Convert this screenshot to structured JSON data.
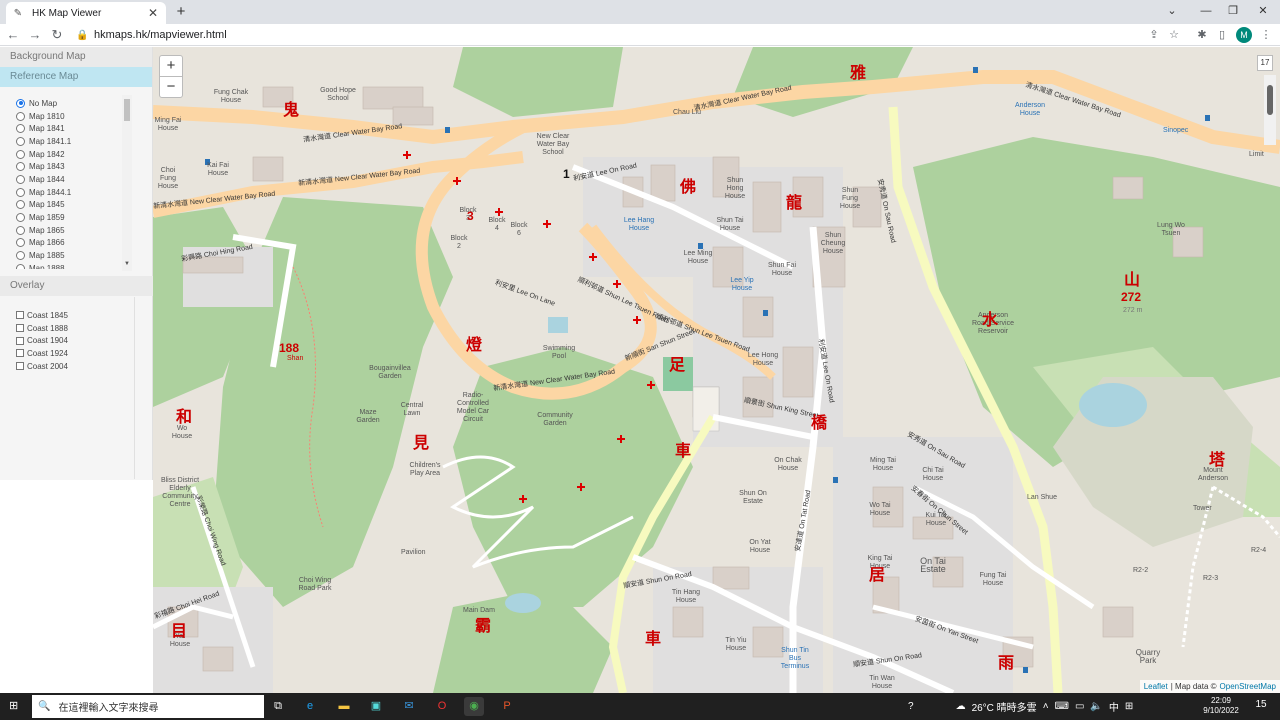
{
  "browser": {
    "tab_title": "HK Map Viewer",
    "tab_icon": "map-pin-icon",
    "new_tab": "+",
    "url": "hkmaps.hk/mapviewer.html",
    "window_buttons": [
      "⌄",
      "—",
      "❐",
      "✕"
    ],
    "avatar_letter": "M"
  },
  "sidebar": {
    "background_map_label": "Background Map",
    "reference_map_label": "Reference Map",
    "maps": [
      {
        "label": "No Map",
        "selected": true
      },
      {
        "label": "Map 1810",
        "selected": false
      },
      {
        "label": "Map 1841",
        "selected": false
      },
      {
        "label": "Map 1841.1",
        "selected": false
      },
      {
        "label": "Map 1842",
        "selected": false
      },
      {
        "label": "Map 1843",
        "selected": false
      },
      {
        "label": "Map 1844",
        "selected": false
      },
      {
        "label": "Map 1844.1",
        "selected": false
      },
      {
        "label": "Map 1845",
        "selected": false
      },
      {
        "label": "Map 1859",
        "selected": false
      },
      {
        "label": "Map 1865",
        "selected": false
      },
      {
        "label": "Map 1866",
        "selected": false
      },
      {
        "label": "Map 1885",
        "selected": false
      },
      {
        "label": "Map 1888",
        "selected": false
      }
    ],
    "overlay_label": "Overlay",
    "overlays": [
      {
        "label": "Coast 1845",
        "checked": false
      },
      {
        "label": "Coast 1888",
        "checked": false
      },
      {
        "label": "Coast 1904",
        "checked": false
      },
      {
        "label": "Coast 1924",
        "checked": false
      },
      {
        "label": "Coast 2004",
        "checked": false
      }
    ]
  },
  "map": {
    "zoom_in": "+",
    "zoom_out": "−",
    "zoom_level": "17",
    "attribution": {
      "leaflet": "Leaflet",
      "sep": "| Map data ©",
      "osm": "OpenStreetMap"
    },
    "roads": {
      "clear_water_bay_top": "清水灣道 Clear Water Bay Road",
      "clear_water_bay_right": "清水灣道 Clear Water Bay Road",
      "new_clear_water_bay": "新清水灣道 New Clear Water Bay Road",
      "new_clear_water_bay_left": "新清水灣道 New Clear Water Bay Road",
      "choi_hing": "彩興路 Choi Hing Road",
      "lee_on": "利安道 Lee On Road",
      "shun_lee_tsuen": "順利邨道 Shun Lee Tsuen Road",
      "on_sau": "安秀道 On Sau Road",
      "shun_king": "順景街 Shun King Street",
      "shun_on": "順安道 Shun On Road",
      "on_tat": "安達道 On Tat Road",
      "lee_on_lane": "利安里 Lee On Lane",
      "san_shun": "新順街 San Shun Street",
      "choi_wing": "彩榮路 Choi Wing Road",
      "choi_hei": "彩禧路 Choi Hei Road",
      "shun_lee_tsuen_2": "順利邨道 Shun Lee Tsuen Road",
      "on_chun": "安春街 On Chun Street",
      "on_yan": "安茵街 On Yan Street"
    },
    "places": {
      "chau_liu": "Chau Liu",
      "fung_chak": "Fung Chak House",
      "good_hope": "Good Hope School",
      "kai_fai": "Kai Fai House",
      "ming_fai": "Ming Fai House",
      "choi_hing_house": "Choi Fung House",
      "block3": "Block 3",
      "block4": "Block 4",
      "block6": "Block 6",
      "block2": "Block 2",
      "shun_hong": "Shun Hong House",
      "shun_tai": "Shun Tai House",
      "shun_fung": "Shun Fung House",
      "shun_cheung": "Shun Cheung House",
      "shun_fai": "Shun Fai House",
      "lee_ming": "Lee Ming House",
      "lee_yip": "Lee Yip House",
      "lee_hong": "Lee Hong House",
      "lee_hang": "Lee Hang House",
      "swimming_pool": "Swimming Pool",
      "bougainvillea": "Bougainvillea Garden",
      "central_lawn": "Central Lawn",
      "maze_garden": "Maze Garden",
      "radio_model": "Radio-Controlled Model Car Circuit",
      "community_garden": "Community Garden",
      "childrens_play": "Children's Play Area",
      "wo_house": "Wo House",
      "bliss": "Bliss District Elderly Community Centre",
      "pavilion": "Pavilion",
      "choi_wing_park": "Choi Wing Road Park",
      "yat_house": "Yat House",
      "main_dam": "Main Dam",
      "shun_on_estate": "Shun On Estate",
      "on_yat": "On Yat House",
      "on_chak": "On Chak House",
      "on_tai_estate": "On Tai Estate",
      "tin_hang": "Tin Hang House",
      "tin_yiu": "Tin Yiu House",
      "tin_wan": "Tin Wan House",
      "shun_tin_bus": "Shun Tin Bus Terminus",
      "fung_tai": "Fung Tai House",
      "ming_tai": "Ming Tai House",
      "chi_tai": "Chi Tai House",
      "wo_tai": "Wo Tai House",
      "kui_tai": "Kui Tai House",
      "king_tai": "King Tai House",
      "anderson": "Anderson Road Service Reservoir",
      "lung_wo": "Lung Wo Tsuen",
      "lan_shue": "Lan Shue",
      "mount_anderson": "Mount Anderson",
      "quarry_park": "Quarry Park",
      "tower": "Tower",
      "anderson_house": "Anderson House",
      "sinopec": "Sinopec",
      "cwb_primary": "New Clear Water Bay School",
      "r2_2": "R2-2",
      "r2_3": "R2-3",
      "r2_4": "R2-4",
      "limit": "Limit",
      "shun_tin": "Shun Tin"
    },
    "red_markers": {
      "mark_188": "188",
      "mark_188_sub": "Shan",
      "mark_272": "272",
      "mark_272_sub": "272 m",
      "mark_3": "3",
      "mark_1": "1",
      "char_a": "雅",
      "char_b": "鬼",
      "char_c": "燈",
      "char_d": "足",
      "char_e": "車",
      "char_f": "橋",
      "char_g": "和",
      "char_h": "見",
      "char_i": "目",
      "char_j": "霸",
      "char_k": "車",
      "char_l": "山",
      "char_m": "水",
      "char_n": "居",
      "char_o": "雨",
      "char_p": "塔",
      "char_q": "龍",
      "char_r": "佛"
    }
  },
  "taskbar": {
    "search_placeholder": "在這裡輸入文字來搜尋",
    "weather": "26°C 晴時多雲",
    "ime": "中",
    "time": "22:09",
    "date": "9/10/2022",
    "notif_count": "15"
  }
}
